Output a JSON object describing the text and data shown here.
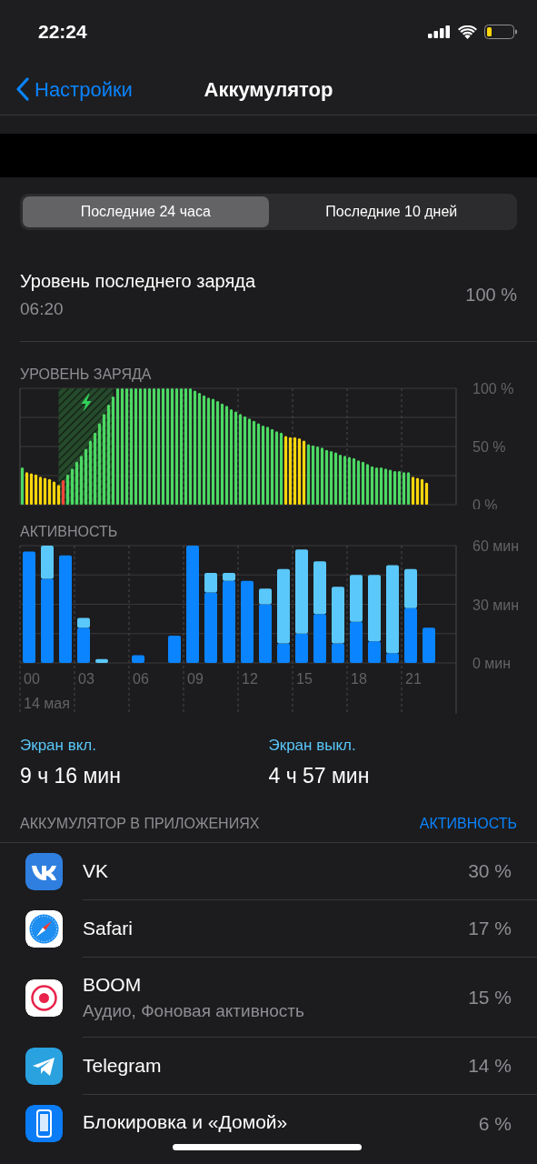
{
  "status_bar": {
    "time": "22:24"
  },
  "nav": {
    "back": "Настройки",
    "title": "Аккумулятор"
  },
  "tabs": [
    {
      "label": "Последние 24 часа",
      "selected": true
    },
    {
      "label": "Последние 10 дней",
      "selected": false
    }
  ],
  "last_charge": {
    "label": "Уровень последнего заряда",
    "time": "06:20",
    "value": "100 %"
  },
  "battery_chart": {
    "title": "УРОВЕНЬ ЗАРЯДА",
    "chart_data": {
      "type": "bar",
      "ylim": [
        0,
        100
      ],
      "yticks": [
        {
          "value": 0,
          "label": "0 %"
        },
        {
          "value": 50,
          "label": "50 %"
        },
        {
          "value": 100,
          "label": "100 %"
        }
      ],
      "stacked": true,
      "categories": [
        null,
        null,
        null,
        null,
        null,
        null,
        null,
        null,
        null,
        null,
        null,
        null,
        null,
        null,
        null,
        null,
        null,
        null,
        null,
        null,
        null,
        null,
        null,
        null,
        null,
        null,
        null,
        null,
        null,
        null,
        null,
        null,
        null,
        null,
        null,
        null,
        null,
        null,
        null,
        null,
        null,
        null,
        null,
        null,
        null,
        null,
        null,
        null,
        null,
        null,
        null,
        null,
        null,
        null,
        null,
        null,
        null,
        null,
        null,
        null,
        null,
        null,
        null,
        null,
        null,
        null,
        null,
        null,
        null,
        null,
        null,
        null,
        null,
        null,
        null,
        null,
        null,
        null,
        null,
        null,
        null,
        null,
        null,
        null,
        null,
        null,
        null,
        null,
        null,
        null
      ],
      "series": [
        {
          "color": "#4cd964",
          "values": [
            32,
            null,
            null,
            null,
            null,
            null,
            null,
            null,
            null,
            null,
            26,
            31,
            37,
            42,
            48,
            55,
            62,
            70,
            78,
            86,
            93,
            100,
            100,
            100,
            100,
            100,
            100,
            100,
            100,
            100,
            100,
            100,
            100,
            100,
            100,
            100,
            100,
            100,
            98,
            96,
            94,
            92,
            91,
            89,
            87,
            85,
            82,
            80,
            78,
            76,
            74,
            72,
            70,
            68,
            67,
            65,
            63,
            62,
            null,
            null,
            null,
            null,
            null,
            52,
            51,
            50,
            49,
            47,
            46,
            45,
            43,
            42,
            41,
            40,
            38,
            37,
            35,
            33,
            32,
            32,
            31,
            30,
            29,
            29,
            28,
            28,
            null,
            null,
            null,
            null
          ]
        },
        {
          "color": "#ffd60a",
          "values": [
            null,
            28,
            27,
            26,
            24,
            23,
            22,
            20,
            17,
            null,
            null,
            null,
            null,
            null,
            null,
            null,
            null,
            null,
            null,
            null,
            null,
            null,
            null,
            null,
            null,
            null,
            null,
            null,
            null,
            null,
            null,
            null,
            null,
            null,
            null,
            null,
            null,
            null,
            null,
            null,
            null,
            null,
            null,
            null,
            null,
            null,
            null,
            null,
            null,
            null,
            null,
            null,
            null,
            null,
            null,
            null,
            null,
            null,
            59,
            58,
            58,
            57,
            55,
            null,
            null,
            null,
            null,
            null,
            null,
            null,
            null,
            null,
            null,
            null,
            null,
            null,
            null,
            null,
            null,
            null,
            null,
            null,
            null,
            null,
            null,
            null,
            24,
            23,
            22,
            19
          ]
        },
        {
          "color": "#ff453a",
          "values": [
            null,
            null,
            null,
            null,
            null,
            null,
            null,
            null,
            null,
            21,
            null,
            null,
            null,
            null,
            null,
            null,
            null,
            null,
            null,
            null,
            null,
            null,
            null,
            null,
            null,
            null,
            null,
            null,
            null,
            null,
            null,
            null,
            null,
            null,
            null,
            null,
            null,
            null,
            null,
            null,
            null,
            null,
            null,
            null,
            null,
            null,
            null,
            null,
            null,
            null,
            null,
            null,
            null,
            null,
            null,
            null,
            null,
            null,
            null,
            null,
            null,
            null,
            null,
            null,
            null,
            null,
            null,
            null,
            null,
            null,
            null,
            null,
            null,
            null,
            null,
            null,
            null,
            null,
            null,
            null,
            null,
            null,
            null,
            null,
            null,
            null,
            null,
            null,
            null,
            null
          ]
        }
      ]
    }
  },
  "activity_chart": {
    "title": "АКТИВНОСТЬ",
    "date": "14 мая",
    "chart_data": {
      "type": "bar",
      "stacked": true,
      "ylim": [
        0,
        60
      ],
      "x": [
        0,
        1,
        2,
        3,
        4,
        5,
        6,
        7,
        8,
        9,
        10,
        11,
        12,
        13,
        14,
        15,
        16,
        17,
        18,
        19,
        20,
        21,
        22
      ],
      "xlim": [
        -0.5,
        23.5
      ],
      "xticks": [
        {
          "value": 0,
          "label": "00"
        },
        {
          "value": 3,
          "label": "03"
        },
        {
          "value": 6,
          "label": "06"
        },
        {
          "value": 9,
          "label": "09"
        },
        {
          "value": 12,
          "label": "12"
        },
        {
          "value": 15,
          "label": "15"
        },
        {
          "value": 18,
          "label": "18"
        },
        {
          "value": 21,
          "label": "21"
        }
      ],
      "yticks": [
        {
          "value": 0,
          "label": "0 мин"
        },
        {
          "value": 30,
          "label": "30 мин"
        },
        {
          "value": 60,
          "label": "60 мин"
        }
      ],
      "series": [
        {
          "color": "#0a84ff",
          "values": [
            57,
            43,
            55,
            18,
            0,
            0,
            4,
            0,
            14,
            60,
            36,
            42,
            42,
            30,
            10,
            15,
            25,
            10,
            21,
            11,
            5,
            28,
            18
          ]
        },
        {
          "color": "#5ac8fa",
          "values": [
            0,
            17,
            0,
            5,
            2,
            0,
            0,
            0,
            0,
            0,
            10,
            4,
            0,
            8,
            38,
            43,
            27,
            29,
            24,
            34,
            45,
            20,
            0
          ]
        }
      ]
    }
  },
  "screen_stats": [
    {
      "label": "Экран вкл.",
      "value": "9 ч 16 мин"
    },
    {
      "label": "Экран выкл.",
      "value": "4 ч 57 мин"
    }
  ],
  "apps_section": {
    "title": "АККУМУЛЯТОР В ПРИЛОЖЕНИЯХ",
    "link": "АКТИВНОСТЬ"
  },
  "apps": [
    {
      "kind": "vk",
      "name": "VK",
      "percent": "30 %"
    },
    {
      "kind": "compass",
      "name": "Safari",
      "percent": "17 %"
    },
    {
      "kind": "ring",
      "name": "BOOM",
      "detail": "Аудио, Фоновая активность",
      "percent": "15 %"
    },
    {
      "kind": "plane",
      "name": "Telegram",
      "percent": "14 %"
    },
    {
      "kind": "phone",
      "name": "Блокировка и «Домой»",
      "percent": "6 %"
    }
  ]
}
